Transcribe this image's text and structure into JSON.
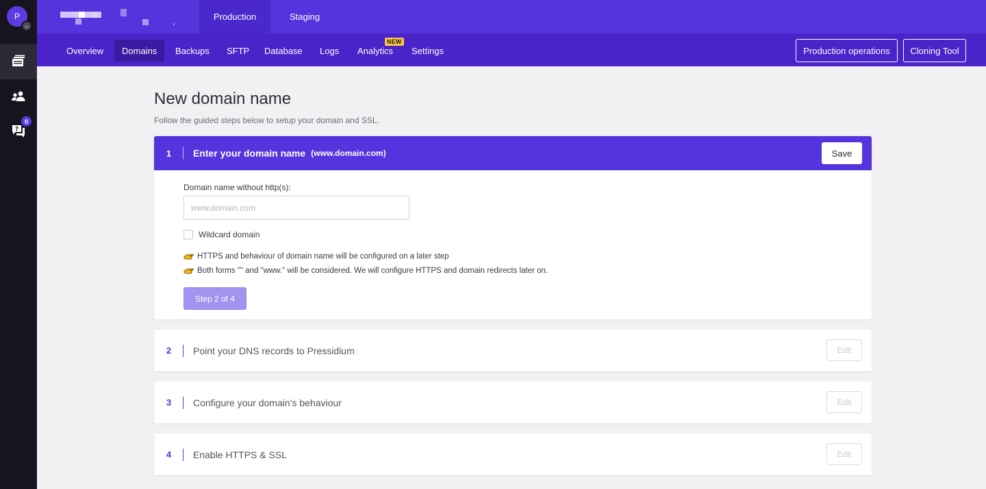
{
  "sidebar": {
    "avatar_letter": "P",
    "avatar_badge_icon": "code-icon",
    "items": [
      {
        "icon": "sites-stack-icon",
        "active": true
      },
      {
        "icon": "users-icon",
        "active": false
      },
      {
        "icon": "support-chat-icon",
        "active": false,
        "badge": "0"
      }
    ]
  },
  "topbar": {
    "env_tabs": [
      {
        "label": "Production",
        "active": true
      },
      {
        "label": "Staging",
        "active": false
      }
    ]
  },
  "subnav": {
    "items": [
      {
        "label": "Overview",
        "active": false
      },
      {
        "label": "Domains",
        "active": true
      },
      {
        "label": "Backups",
        "active": false
      },
      {
        "label": "SFTP",
        "active": false
      },
      {
        "label": "Database",
        "active": false
      },
      {
        "label": "Logs",
        "active": false
      },
      {
        "label": "Analytics",
        "active": false
      },
      {
        "label": "Settings",
        "active": false
      }
    ],
    "new_badge": "NEW",
    "production_operations": "Production operations",
    "cloning_tool": "Cloning Tool"
  },
  "page": {
    "title": "New domain name",
    "subtitle": "Follow the guided steps below to setup your domain and SSL."
  },
  "steps": [
    {
      "number": "1",
      "title": "Enter your domain name",
      "hint": "(www.domain.com)",
      "action": "Save",
      "field_label": "Domain name without http(s):",
      "input_placeholder": "www.domain.com",
      "input_value": "",
      "wildcard_label": "Wildcard domain",
      "wildcard_checked": false,
      "notes": [
        "HTTPS and behaviour of domain name will be configured on a later step",
        "Both forms \"\" and \"www.\" will be considered. We will configure HTTPS and domain redirects later on."
      ],
      "next_button": "Step 2 of 4"
    },
    {
      "number": "2",
      "title": "Point your DNS records to Pressidium",
      "action": "Edit"
    },
    {
      "number": "3",
      "title": "Configure your domain’s behaviour",
      "action": "Edit"
    },
    {
      "number": "4",
      "title": "Enable HTTPS & SSL",
      "action": "Edit"
    }
  ],
  "colors": {
    "brand": "#5533dd",
    "subnav": "#4a23c9",
    "sidebar": "#17141f",
    "new_badge": "#f4c84a",
    "step_button": "#a393f0"
  }
}
